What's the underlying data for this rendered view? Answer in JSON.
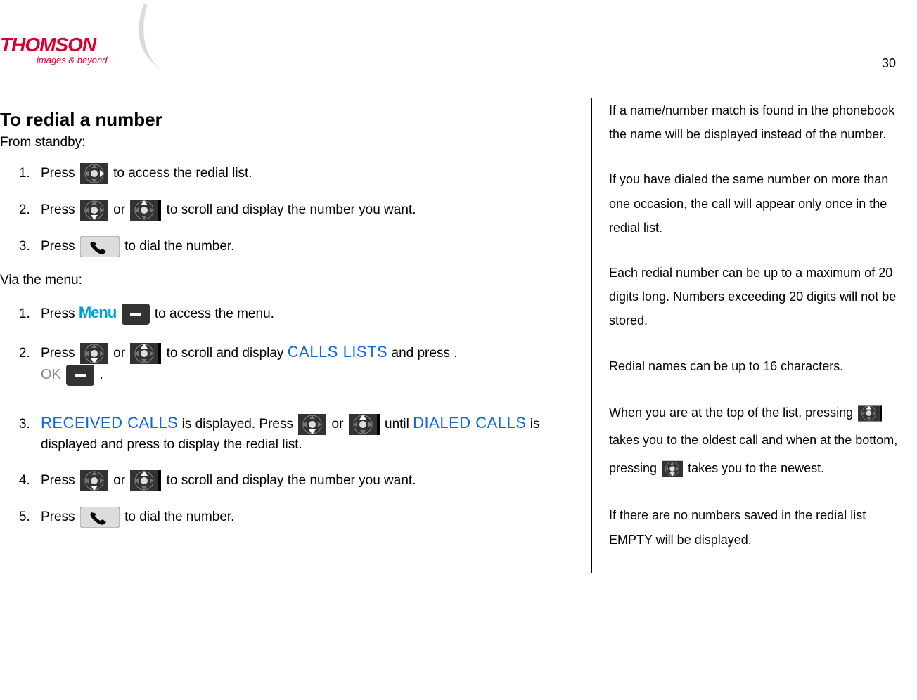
{
  "logo": {
    "brand": "THOMSON",
    "tagline": "images & beyond"
  },
  "page_number": "30",
  "left": {
    "heading": "To redial a number",
    "sub1": "From standby:",
    "standby_steps": [
      {
        "pre": "Press ",
        "post": "to access the redial list."
      },
      {
        "pre": "Press ",
        "mid": "or ",
        "post": "to scroll and display the number you want."
      },
      {
        "pre": "Press ",
        "post": "to dial the number."
      }
    ],
    "sub2": "Via the menu:",
    "menu_label": "Menu",
    "ok_label": "OK",
    "emph_calls_lists": "CALLS LISTS",
    "emph_received": "RECEIVED CALLS",
    "emph_dialed": "DIALED CALLS",
    "menu_steps": {
      "s1_pre": "Press ",
      "s1_post": "to access the menu.",
      "s2_pre": "Press ",
      "s2_mid": "or ",
      "s2_post1": "to scroll and display ",
      "s2_post2": " and press . ",
      "s2_end": ".",
      "s3_mid": " is displayed.  Press ",
      "s3_mid2": " or ",
      "s3_until": "until ",
      "s3_tail": " is displayed and press to display the redial list.",
      "s4_pre": "Press ",
      "s4_mid": "or ",
      "s4_post": "to scroll and display the number you want.",
      "s5_pre": "Press ",
      "s5_post": "to dial the number."
    }
  },
  "right": {
    "p1": "If a name/number match is found in the phonebook the name will be displayed instead of the number.",
    "p2": "If you have dialed the same number on more than one occasion, the call will appear only once in the redial list.",
    "p3": "Each redial number can be up to a maximum of 20 digits long. Numbers exceeding 20 digits will not be stored.",
    "p4": "Redial names can be up to 16 characters.",
    "p5a": "When you are at the top of the list, pressing ",
    "p5b": "takes you to the oldest call and when at the bottom, pressing ",
    "p5c": "takes you to the newest.",
    "p6": "If there are no numbers saved in the redial list EMPTY will be displayed."
  }
}
